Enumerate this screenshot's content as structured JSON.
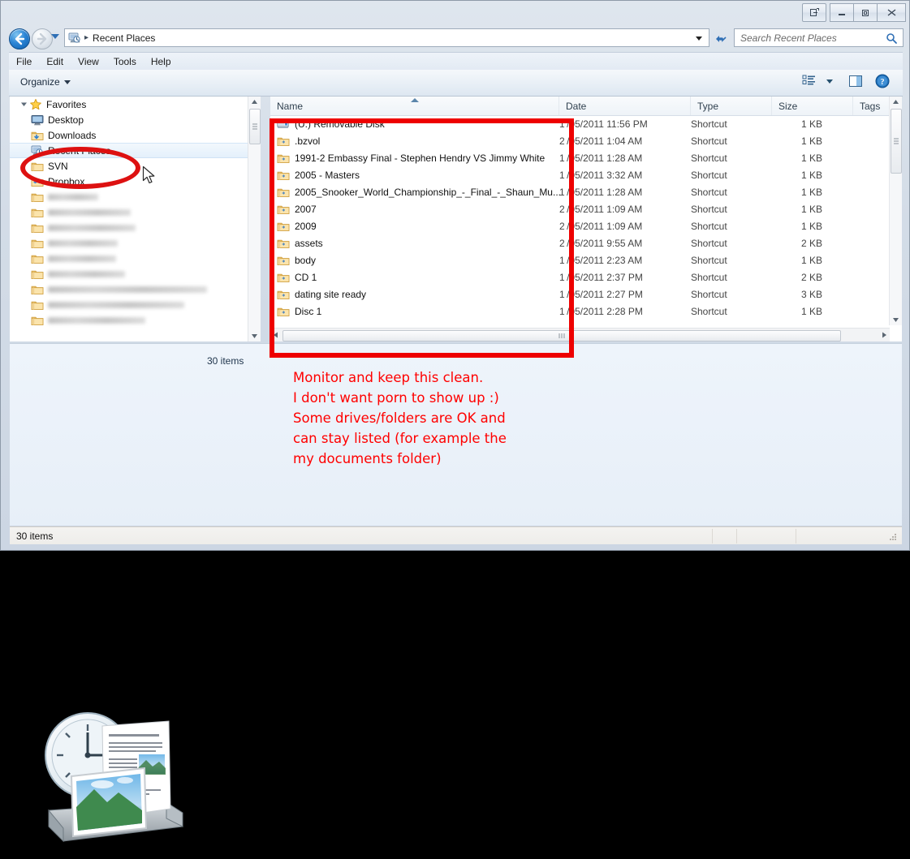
{
  "window": {
    "buttons": {
      "help_label": "?",
      "minimize_label": "—",
      "maximize_label": "▫",
      "close_label": "✕"
    }
  },
  "address_bar": {
    "back_tooltip": "Back",
    "forward_tooltip": "Forward",
    "breadcrumb_icon": "recent-places-icon",
    "path": "Recent Places",
    "separator": "▸"
  },
  "search": {
    "placeholder": "Search Recent Places",
    "value": ""
  },
  "menu": {
    "items": [
      "File",
      "Edit",
      "View",
      "Tools",
      "Help"
    ]
  },
  "toolbar": {
    "organize_label": "Organize",
    "view_icon": "view-list-icon",
    "pane_icon": "preview-pane-icon",
    "help_icon": "help-circle-icon"
  },
  "navigation_pane": {
    "items": [
      {
        "label": "Favorites",
        "icon": "star-icon",
        "level": 0,
        "expanded": true,
        "selected": false,
        "blurred": false
      },
      {
        "label": "Desktop",
        "icon": "desktop-icon",
        "level": 1,
        "selected": false,
        "blurred": false
      },
      {
        "label": "Downloads",
        "icon": "downloads-folder-icon",
        "level": 1,
        "selected": false,
        "blurred": false
      },
      {
        "label": "Recent Places",
        "icon": "recent-places-icon",
        "level": 1,
        "selected": true,
        "blurred": false
      },
      {
        "label": "SVN",
        "icon": "folder-icon",
        "level": 1,
        "selected": false,
        "blurred": false
      },
      {
        "label": "Dropbox",
        "icon": "dropbox-folder-icon",
        "level": 1,
        "selected": false,
        "blurred": false
      },
      {
        "label": "",
        "icon": "folder-icon",
        "level": 1,
        "selected": false,
        "blurred": true,
        "blur_width": 62
      },
      {
        "label": "",
        "icon": "folder-icon",
        "level": 1,
        "selected": false,
        "blurred": true,
        "blur_width": 102
      },
      {
        "label": "",
        "icon": "folder-icon",
        "level": 1,
        "selected": false,
        "blurred": true,
        "blur_width": 108
      },
      {
        "label": "",
        "icon": "folder-icon",
        "level": 1,
        "selected": false,
        "blurred": true,
        "blur_width": 86
      },
      {
        "label": "",
        "icon": "folder-icon",
        "level": 1,
        "selected": false,
        "blurred": true,
        "blur_width": 84
      },
      {
        "label": "",
        "icon": "folder-icon",
        "level": 1,
        "selected": false,
        "blurred": true,
        "blur_width": 95
      },
      {
        "label": "",
        "icon": "folder-icon",
        "level": 1,
        "selected": false,
        "blurred": true,
        "blur_width": 196
      },
      {
        "label": "",
        "icon": "folder-icon",
        "level": 1,
        "selected": false,
        "blurred": true,
        "blur_width": 168
      },
      {
        "label": "",
        "icon": "folder-icon",
        "level": 1,
        "selected": false,
        "blurred": true,
        "blur_width": 120
      }
    ]
  },
  "file_list": {
    "columns": [
      {
        "key": "name",
        "label": "Name"
      },
      {
        "key": "date",
        "label": "Date"
      },
      {
        "key": "type",
        "label": "Type"
      },
      {
        "key": "size",
        "label": "Size"
      },
      {
        "key": "tags",
        "label": "Tags"
      }
    ],
    "sort_column": "Name",
    "sort_direction": "ascending",
    "rows": [
      {
        "name": "(U:) Removable Disk",
        "icon": "removable-disk-icon",
        "date": "1 /05/2011 11:56 PM",
        "type": "Shortcut",
        "size": "1 KB",
        "tags": ""
      },
      {
        "name": ".bzvol",
        "icon": "folder-shortcut-icon",
        "date": "2 /05/2011 1:04 AM",
        "type": "Shortcut",
        "size": "1 KB",
        "tags": ""
      },
      {
        "name": "1991-2 Embassy  Final - Stephen Hendry VS Jimmy White",
        "icon": "folder-shortcut-icon",
        "date": "1 /05/2011 1:28 AM",
        "type": "Shortcut",
        "size": "1 KB",
        "tags": ""
      },
      {
        "name": "2005 - Masters",
        "icon": "folder-shortcut-icon",
        "date": "1 /05/2011 3:32 AM",
        "type": "Shortcut",
        "size": "1 KB",
        "tags": ""
      },
      {
        "name": "2005_Snooker_World_Championship_-_Final_-_Shaun_Mu...",
        "icon": "folder-shortcut-icon",
        "date": "1 /05/2011 1:28 AM",
        "type": "Shortcut",
        "size": "1 KB",
        "tags": ""
      },
      {
        "name": "2007",
        "icon": "folder-shortcut-icon",
        "date": "2 /05/2011 1:09 AM",
        "type": "Shortcut",
        "size": "1 KB",
        "tags": ""
      },
      {
        "name": "2009",
        "icon": "folder-shortcut-icon",
        "date": "2 /05/2011 1:09 AM",
        "type": "Shortcut",
        "size": "1 KB",
        "tags": ""
      },
      {
        "name": "assets",
        "icon": "folder-shortcut-icon",
        "date": "2 /05/2011 9:55 AM",
        "type": "Shortcut",
        "size": "2 KB",
        "tags": ""
      },
      {
        "name": "body",
        "icon": "folder-shortcut-icon",
        "date": "1 /05/2011 2:23 AM",
        "type": "Shortcut",
        "size": "1 KB",
        "tags": ""
      },
      {
        "name": "CD 1",
        "icon": "folder-shortcut-icon",
        "date": "1 /05/2011 2:37 PM",
        "type": "Shortcut",
        "size": "2 KB",
        "tags": ""
      },
      {
        "name": "dating site ready",
        "icon": "folder-shortcut-icon",
        "date": "1 /05/2011 2:27 PM",
        "type": "Shortcut",
        "size": "3 KB",
        "tags": ""
      },
      {
        "name": "Disc 1",
        "icon": "folder-shortcut-icon",
        "date": "1 /05/2011 2:28 PM",
        "type": "Shortcut",
        "size": "1 KB",
        "tags": ""
      }
    ]
  },
  "details_pane": {
    "item_count": "30 items",
    "preview_icon": "recent-places-large-icon"
  },
  "status_bar": {
    "text": "30 items"
  },
  "annotations": {
    "note_text": "Monitor and keep this clean.\nI don't want porn to show up :)\nSome drives/folders are OK and\ncan stay listed (for example the\nmy documents folder)",
    "note_color": "#ff0000",
    "box_color": "#ee0000",
    "ellipse_color": "#dd1111",
    "ellipse_target": "Recent Places",
    "box_target": "file-list"
  }
}
